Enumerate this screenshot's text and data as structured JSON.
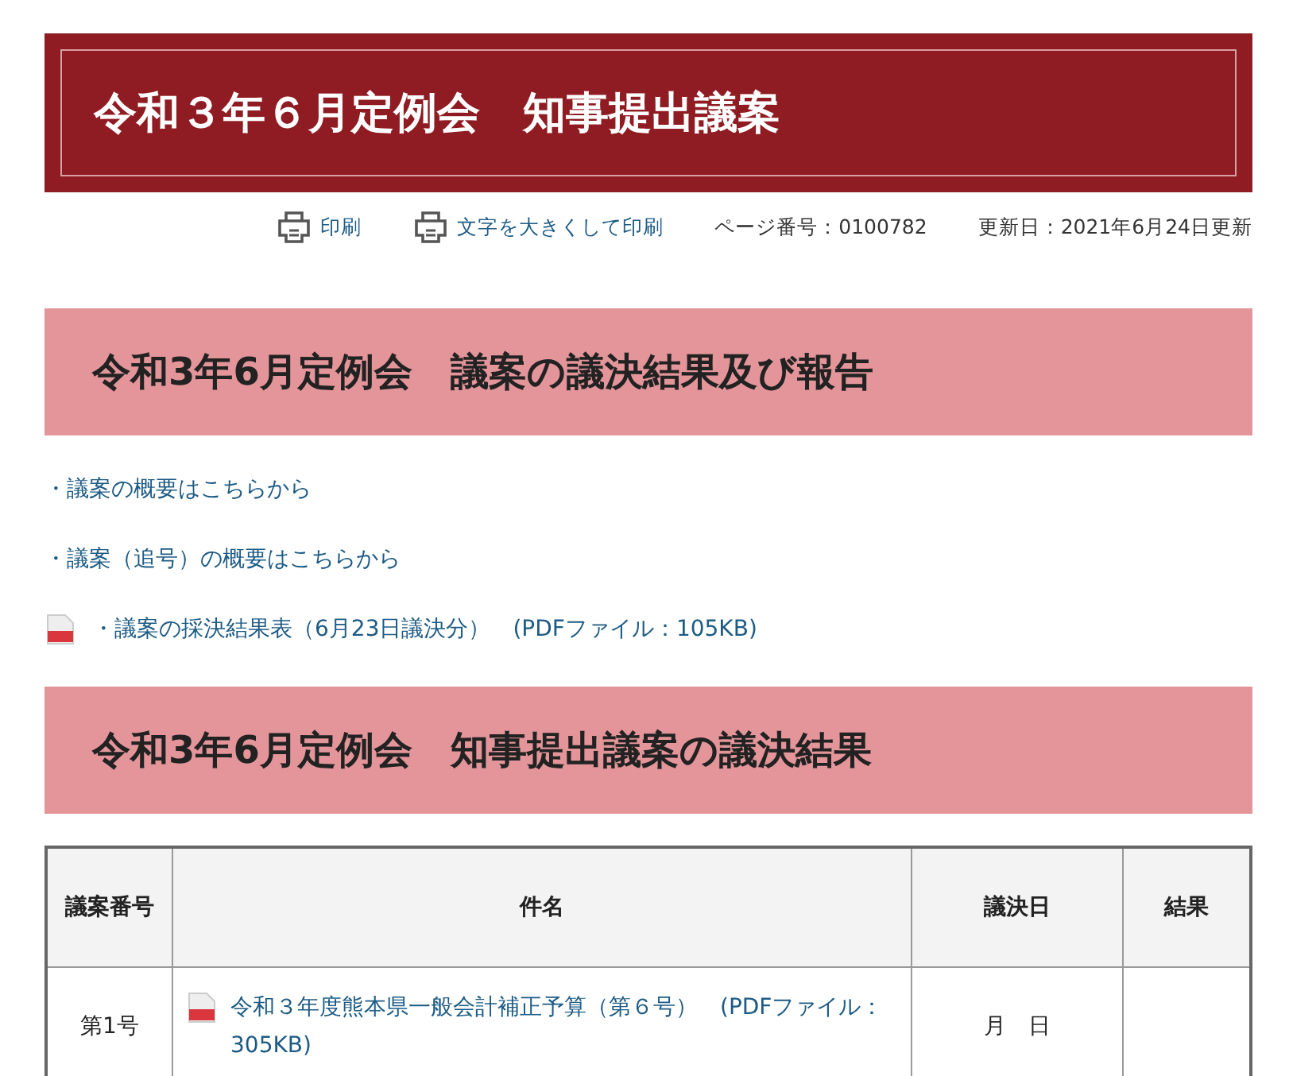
{
  "page_title": "令和３年６月定例会　知事提出議案",
  "tools": [
    {
      "kind": "print",
      "label": "印刷"
    },
    {
      "kind": "print",
      "label": "文字を大きくして印刷"
    },
    {
      "kind": "text",
      "label": "ページ番号：0100782"
    },
    {
      "kind": "text",
      "label": "更新日：2021年6月24日更新"
    }
  ],
  "sections": [
    {
      "heading": "令和3年6月定例会　議案の議決結果及び報告",
      "links": [
        {
          "text": "・議案の概要はこちらから",
          "pdf": false
        },
        {
          "text": "・議案（追号）の概要はこちらから",
          "pdf": false
        },
        {
          "text": "・議案の採決結果表（6月23日議決分）　(PDFファイル：105KB)",
          "pdf": true
        }
      ]
    },
    {
      "heading": "令和3年6月定例会　知事提出議案の議決結果",
      "table": {
        "columns": [
          "議案番号",
          "件名",
          "議決日",
          "結果"
        ],
        "rows": [
          {
            "number": "第1号",
            "title": "令和３年度熊本県一般会計補正予算（第６号）　(PDFファイル：305KB)",
            "pdf": true,
            "date": "月　日"
          }
        ]
      }
    }
  ]
}
